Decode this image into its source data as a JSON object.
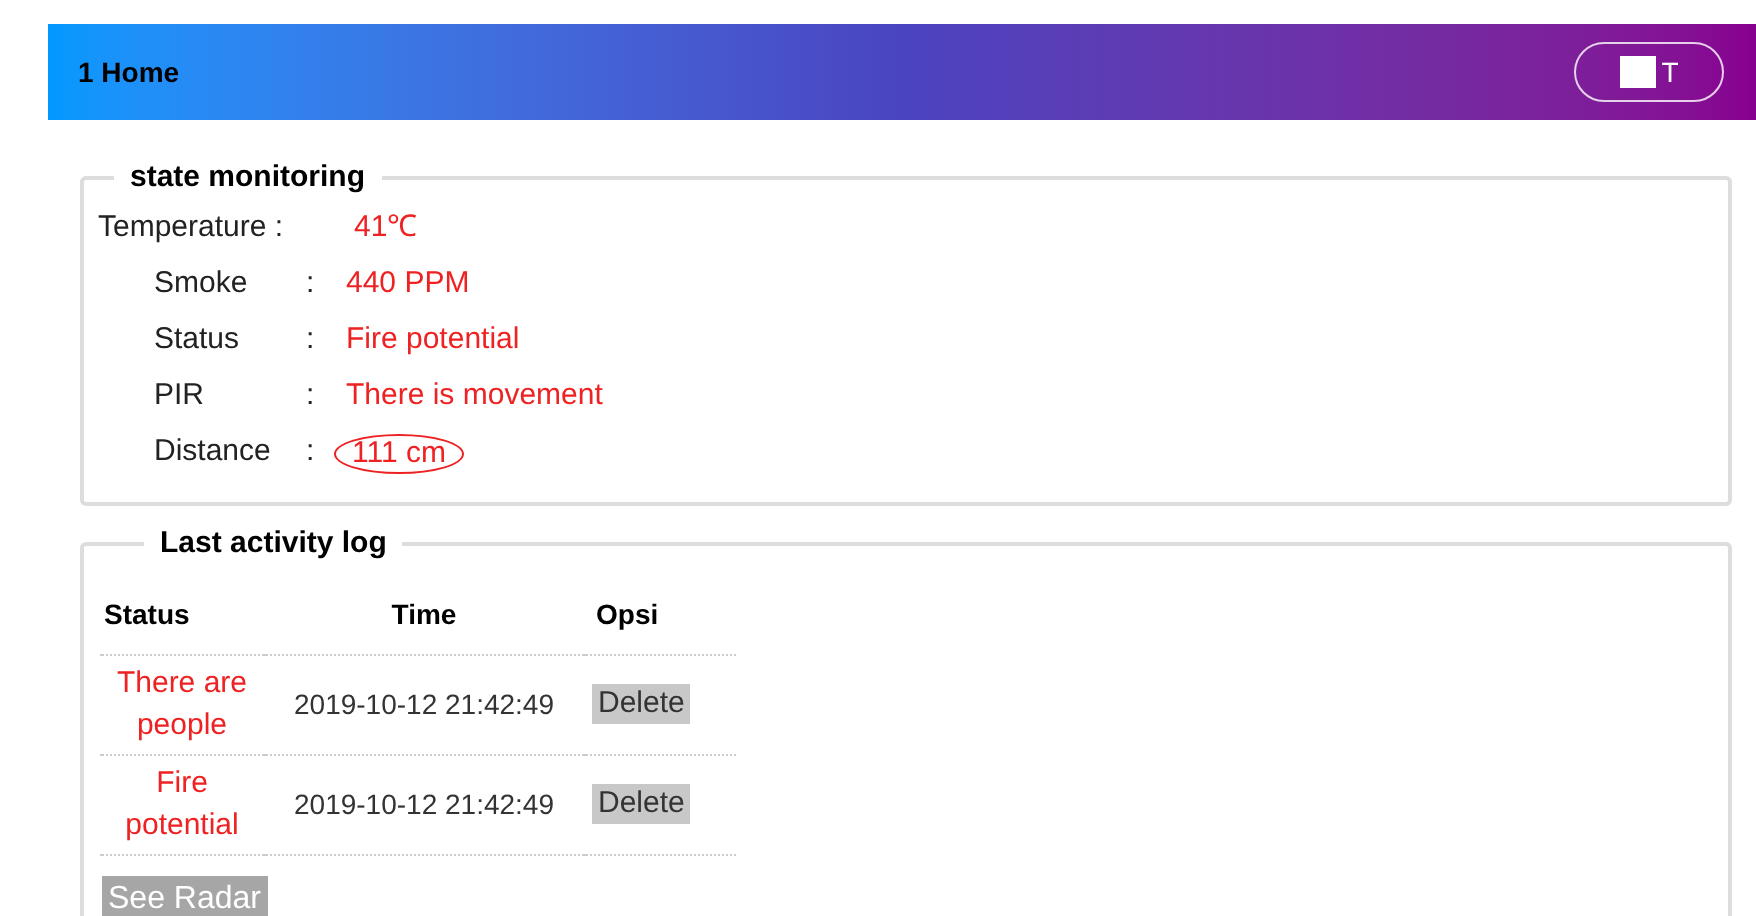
{
  "header": {
    "title": "1 Home",
    "exit_button": {
      "label_after": "T",
      "covered": true
    }
  },
  "state_monitoring": {
    "title": "state monitoring",
    "rows": [
      {
        "label": "Temperature :",
        "colon": "",
        "value": "41℃",
        "circled": false
      },
      {
        "label": "Smoke",
        "colon": ":",
        "value": "440 PPM",
        "circled": false
      },
      {
        "label": "Status",
        "colon": ":",
        "value": "Fire potential",
        "circled": false
      },
      {
        "label": "PIR",
        "colon": ":",
        "value": "There is movement",
        "circled": false
      },
      {
        "label": "Distance",
        "colon": ":",
        "value": "111 cm",
        "circled": true
      }
    ]
  },
  "activity_log": {
    "title": "Last activity log",
    "columns": [
      "Status",
      "Time",
      "Opsi"
    ],
    "rows": [
      {
        "status": "There are people",
        "time": "2019-10-12 21:42:49",
        "action": "Delete"
      },
      {
        "status": "Fire potential",
        "time": "2019-10-12 21:42:49",
        "action": "Delete"
      }
    ],
    "radar_button": {
      "label": "See Radar",
      "disabled": true
    }
  }
}
